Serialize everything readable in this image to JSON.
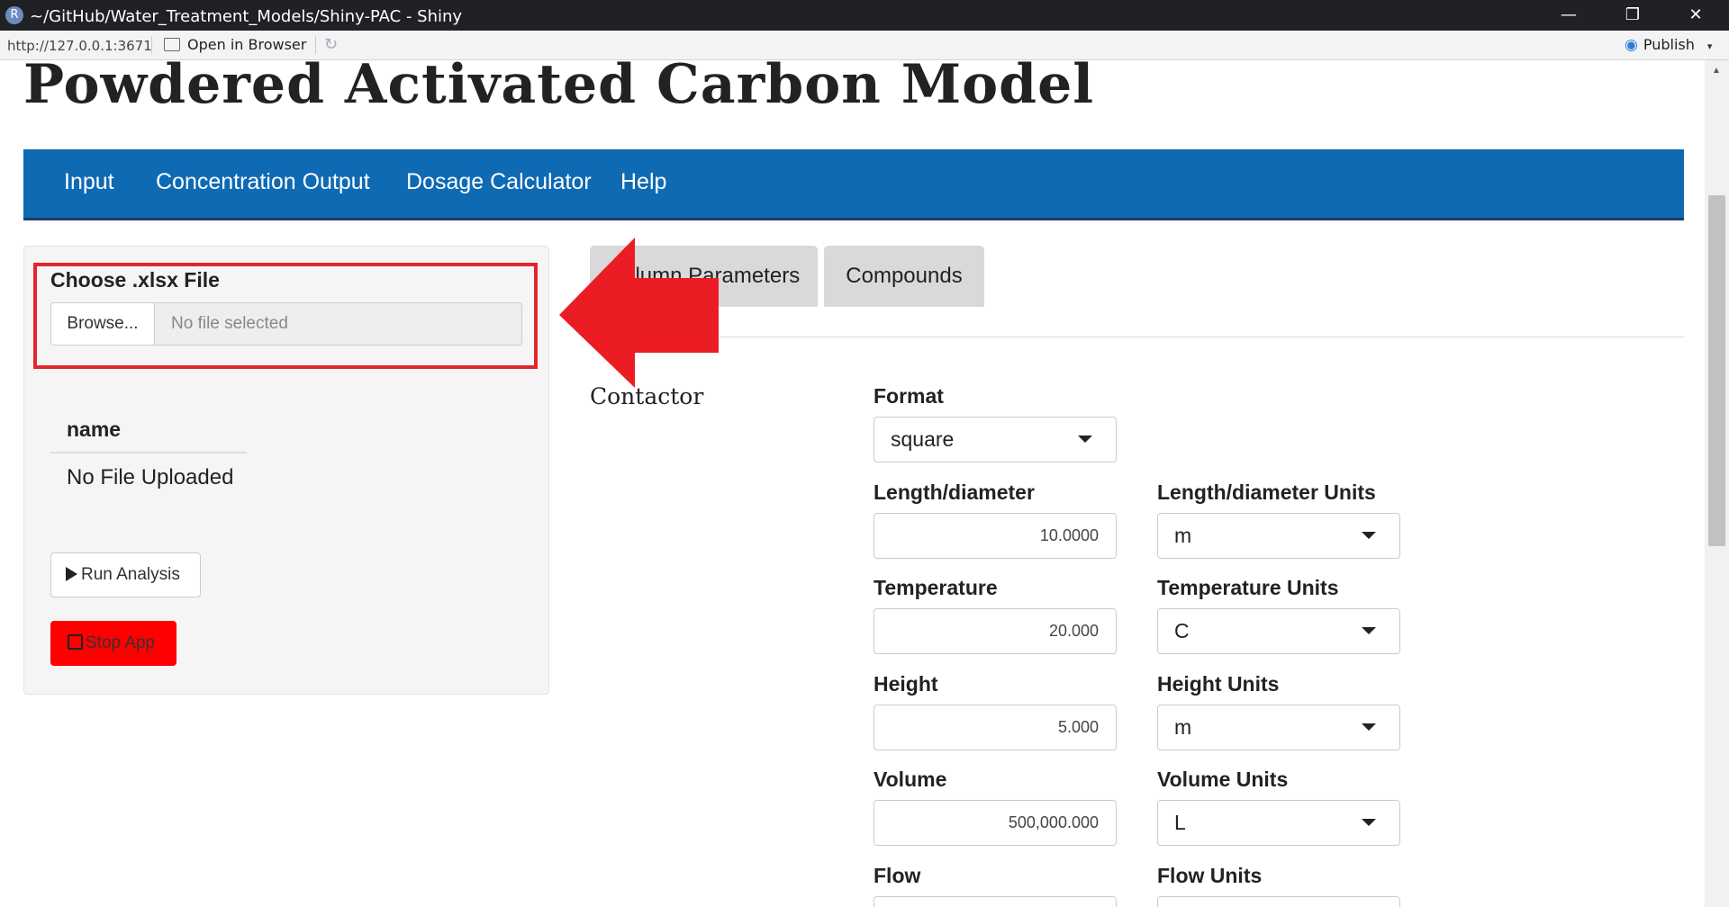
{
  "window": {
    "logo": "R",
    "title": "~/GitHub/Water_Treatment_Models/Shiny-PAC - Shiny",
    "minimize": "—",
    "restore": "❐",
    "close": "✕"
  },
  "toolbar": {
    "url": "http://127.0.0.1:3671",
    "open_in_browser": "Open in Browser",
    "refresh": "↻",
    "publish": "Publish",
    "publish_caret": "▾"
  },
  "app": {
    "title": "Powdered Activated Carbon Model",
    "nav": [
      "Input",
      "Concentration Output",
      "Dosage Calculator",
      "Help"
    ]
  },
  "sidebar": {
    "file_label": "Choose .xlsx File",
    "browse_label": "Browse...",
    "file_placeholder": "No file selected",
    "table_header": "name",
    "table_value": "No File Uploaded",
    "run_label": "Run Analysis",
    "stop_label": "Stop App"
  },
  "tabs": [
    "Column Parameters",
    "Compounds"
  ],
  "contactor": {
    "section_title": "Contactor",
    "format": {
      "label": "Format",
      "value": "square"
    },
    "length": {
      "label": "Length/diameter",
      "value": "10.0000",
      "units_label": "Length/diameter Units",
      "units_value": "m"
    },
    "temperature": {
      "label": "Temperature",
      "value": "20.000",
      "units_label": "Temperature Units",
      "units_value": "C"
    },
    "height": {
      "label": "Height",
      "value": "5.000",
      "units_label": "Height Units",
      "units_value": "m"
    },
    "volume": {
      "label": "Volume",
      "value": "500,000.000",
      "units_label": "Volume Units",
      "units_value": "L"
    },
    "flow": {
      "label": "Flow",
      "units_label": "Flow Units"
    }
  },
  "colors": {
    "navbar": "#0f6ab4",
    "stop_button": "#ff0000",
    "annotation_red": "#e3262c"
  }
}
